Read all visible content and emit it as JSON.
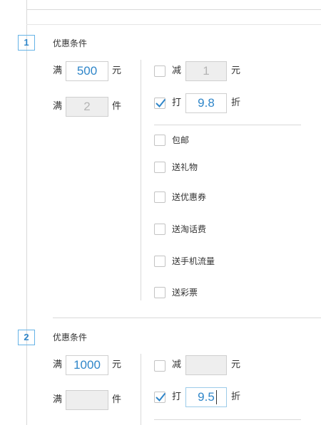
{
  "section1": {
    "index": "1",
    "title": "优惠条件",
    "amount_prefix": "满",
    "amount_value": "500",
    "amount_unit": "元",
    "qty_prefix": "满",
    "qty_value": "2",
    "qty_unit": "件",
    "minus_label": "减",
    "minus_value": "1",
    "minus_unit": "元",
    "minus_checked": false,
    "discount_label": "打",
    "discount_value": "9.8",
    "discount_unit": "折",
    "discount_checked": true,
    "options": [
      {
        "label": "包邮",
        "checked": false
      },
      {
        "label": "送礼物",
        "checked": false
      },
      {
        "label": "送优惠券",
        "checked": false
      },
      {
        "label": "送淘话费",
        "checked": false
      },
      {
        "label": "送手机流量",
        "checked": false
      },
      {
        "label": "送彩票",
        "checked": false
      }
    ]
  },
  "section2": {
    "index": "2",
    "title": "优惠条件",
    "amount_prefix": "满",
    "amount_value": "1000",
    "amount_unit": "元",
    "qty_prefix": "满",
    "qty_value": "",
    "qty_unit": "件",
    "minus_label": "减",
    "minus_value": "",
    "minus_unit": "元",
    "minus_checked": false,
    "discount_label": "打",
    "discount_value": "9.5",
    "discount_unit": "折",
    "discount_checked": true
  },
  "colors": {
    "accent": "#2f86c9",
    "badge_border": "#66b3e6",
    "border": "#cfcfcf",
    "disabled_bg": "#eeeeee",
    "divider": "#d9d9d9"
  }
}
